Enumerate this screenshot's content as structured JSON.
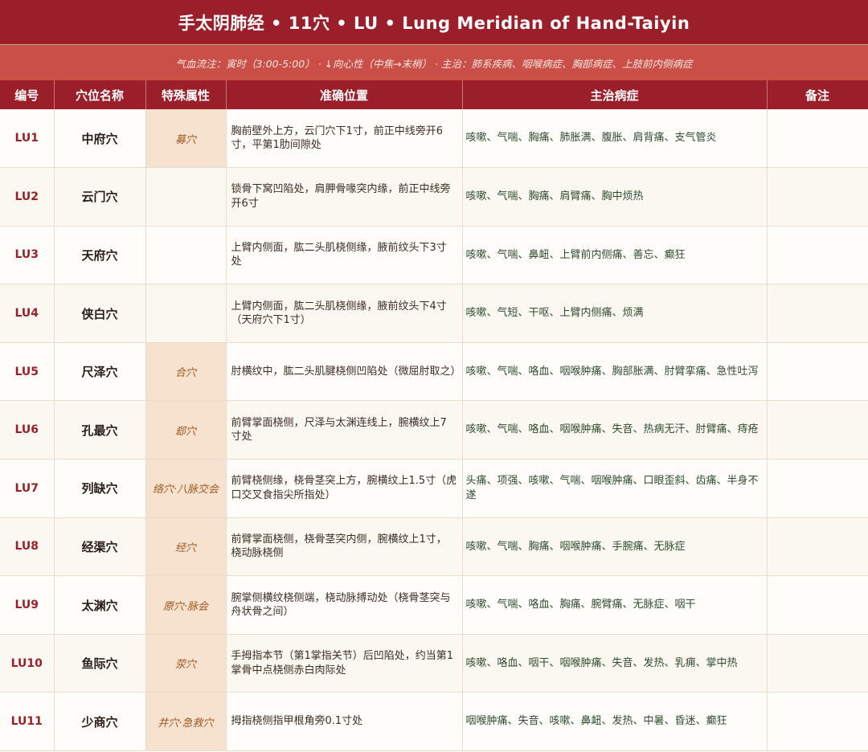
{
  "title": "手太阴肺经 • 11穴  •  LU • Lung Meridian of Hand-Taiyin",
  "subtitle": "气血流注：寅时（3:00-5:00） · ↓向心性（中焦→末梢） · 主治：肺系疾病、咽喉病症、胸部病症、上肢前内侧病症",
  "headers": {
    "code": "编号",
    "name": "穴位名称",
    "attr": "特殊属性",
    "location": "准确位置",
    "indications": "主治病症",
    "notes": "备注"
  },
  "rows": [
    {
      "code": "LU1",
      "name": "中府穴",
      "attr": "募穴",
      "location": "胸前壁外上方，云门穴下1寸，前正中线旁开6寸，平第1肋间隙处",
      "indications": "咳嗽、气喘、胸痛、肺胀满、腹胀、肩背痛、支气管炎",
      "notes": ""
    },
    {
      "code": "LU2",
      "name": "云门穴",
      "attr": "",
      "location": "锁骨下窝凹陷处，肩胛骨喙突内缘，前正中线旁开6寸",
      "indications": "咳嗽、气喘、胸痛、肩臂痛、胸中烦热",
      "notes": ""
    },
    {
      "code": "LU3",
      "name": "天府穴",
      "attr": "",
      "location": "上臂内侧面，肱二头肌桡侧缘，腋前纹头下3寸处",
      "indications": "咳嗽、气喘、鼻衄、上臂前内侧痛、善忘、癫狂",
      "notes": ""
    },
    {
      "code": "LU4",
      "name": "侠白穴",
      "attr": "",
      "location": "上臂内侧面，肱二头肌桡侧缘，腋前纹头下4寸（天府穴下1寸）",
      "indications": "咳嗽、气短、干呕、上臂内侧痛、烦满",
      "notes": ""
    },
    {
      "code": "LU5",
      "name": "尺泽穴",
      "attr": "合穴",
      "location": "肘横纹中，肱二头肌腱桡侧凹陷处（微屈肘取之）",
      "indications": "咳嗽、气喘、咯血、咽喉肿痛、胸部胀满、肘臂挛痛、急性吐泻",
      "notes": ""
    },
    {
      "code": "LU6",
      "name": "孔最穴",
      "attr": "郄穴",
      "location": "前臂掌面桡侧，尺泽与太渊连线上，腕横纹上7寸处",
      "indications": "咳嗽、气喘、咯血、咽喉肿痛、失音、热病无汗、肘臂痛、痔疮",
      "notes": ""
    },
    {
      "code": "LU7",
      "name": "列缺穴",
      "attr": "络穴·八脉交会",
      "location": "前臂桡侧缘，桡骨茎突上方，腕横纹上1.5寸（虎口交叉食指尖所指处）",
      "indications": "头痛、项强、咳嗽、气喘、咽喉肿痛、口眼歪斜、齿痛、半身不遂",
      "notes": ""
    },
    {
      "code": "LU8",
      "name": "经渠穴",
      "attr": "经穴",
      "location": "前臂掌面桡侧，桡骨茎突内侧，腕横纹上1寸，桡动脉桡侧",
      "indications": "咳嗽、气喘、胸痛、咽喉肿痛、手腕痛、无脉症",
      "notes": ""
    },
    {
      "code": "LU9",
      "name": "太渊穴",
      "attr": "原穴·脉会",
      "location": "腕掌侧横纹桡侧端，桡动脉搏动处（桡骨茎突与舟状骨之间）",
      "indications": "咳嗽、气喘、咯血、胸痛、腕臂痛、无脉症、咽干",
      "notes": ""
    },
    {
      "code": "LU10",
      "name": "鱼际穴",
      "attr": "荥穴",
      "location": "手拇指本节（第1掌指关节）后凹陷处，约当第1掌骨中点桡侧赤白肉际处",
      "indications": "咳嗽、咯血、咽干、咽喉肿痛、失音、发热、乳痈、掌中热",
      "notes": ""
    },
    {
      "code": "LU11",
      "name": "少商穴",
      "attr": "井穴·急救穴",
      "location": "拇指桡侧指甲根角旁0.1寸处",
      "indications": "咽喉肿痛、失音、咳嗽、鼻衄、发热、中暑、昏迷、癫狂",
      "notes": ""
    }
  ]
}
